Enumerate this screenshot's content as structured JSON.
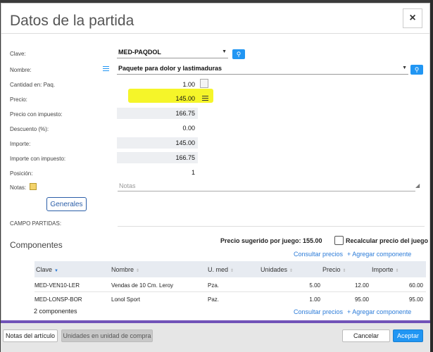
{
  "dialog": {
    "title": "Datos de la partida",
    "close_glyph": "×"
  },
  "labels": {
    "clave": "Clave:",
    "nombre": "Nombre:",
    "cantidad": "Cantidad en: Paq.",
    "precio": "Precio:",
    "precio_impuesto": "Precio con impuesto:",
    "descuento": "Descuento (%):",
    "importe": "Importe:",
    "importe_impuesto": "Importe con impuesto:",
    "posicion": "Posición:",
    "notas": "Notas:",
    "campo_partidas": "CAMPO PARTIDAS:"
  },
  "fields": {
    "clave": "MED-PAQDOL",
    "nombre": "Paquete para dolor y lastimaduras",
    "cantidad": "1.00",
    "precio": "145.00",
    "precio_impuesto": "166.75",
    "descuento": "0.00",
    "importe": "145.00",
    "importe_impuesto": "166.75",
    "posicion": "1",
    "notas_placeholder": "Notas"
  },
  "buttons": {
    "generales": "Generales",
    "notas_articulo": "Notas del artículo",
    "unidades_compra": "Unidades en unidad de compra",
    "cancelar": "Cancelar",
    "aceptar": "Aceptar"
  },
  "components": {
    "title": "Componentes",
    "suggested_price": "Precio sugerido por juego: 155.00",
    "recalc_label": "Recalcular precio del juego",
    "recalc_checked": false,
    "consultar_precios": "Consultar precios",
    "agregar_componente": "+ Agregar componente",
    "headers": [
      "Clave",
      "Nombre",
      "U. med",
      "Unidades",
      "Precio",
      "Importe"
    ],
    "rows": [
      [
        "MED-VEN10-LER",
        "Vendas de 10 Cm. Leroy",
        "Pza.",
        "5.00",
        "12.00",
        "60.00"
      ],
      [
        "MED-LONSP-BOR",
        "Lonol Sport",
        "Paz.",
        "1.00",
        "95.00",
        "95.00"
      ]
    ],
    "count": "2 componentes"
  },
  "colors": {
    "accent": "#2196f3",
    "highlight": "#f5f529",
    "link": "#2b7bd8"
  }
}
